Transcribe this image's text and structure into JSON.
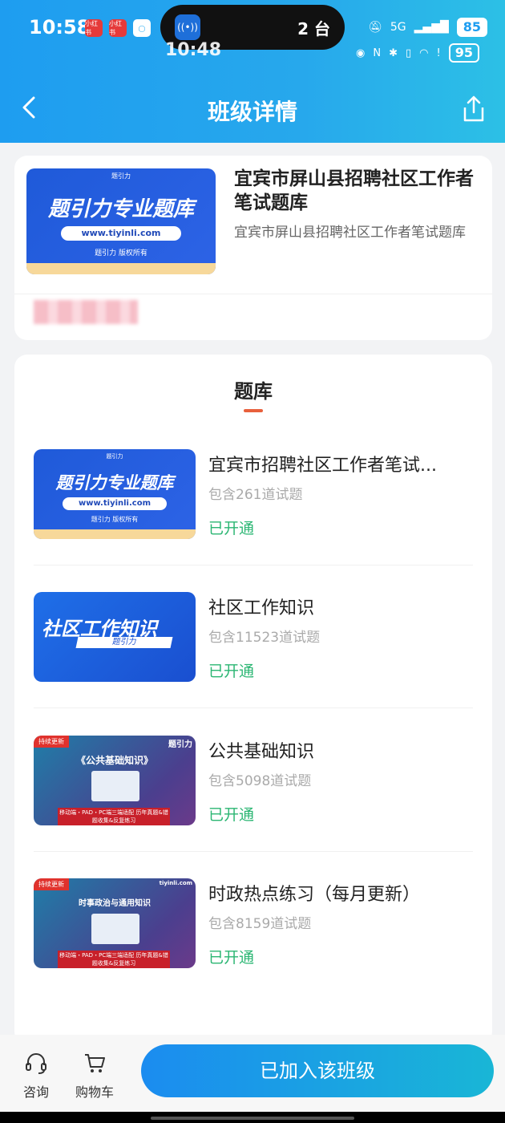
{
  "status_bar": {
    "time": "10:58",
    "badge1": "小红书",
    "badge2": "小红书",
    "island_count": "2 台",
    "signal": "5G",
    "battery": "85",
    "ghost_time": "10:48",
    "ghost_battery": "95"
  },
  "nav": {
    "title": "班级详情",
    "back_icon": "chevron-left-icon",
    "share_icon": "share-icon"
  },
  "course": {
    "title": "宜宾市屏山县招聘社区工作者笔试题库",
    "subtitle": "宜宾市屏山县招聘社区工作者笔试题库",
    "thumb_big": "题引力专业题库",
    "thumb_url": "www.tiyinli.com",
    "thumb_owner": "题引力 版权所有",
    "thumb_brand": "题引力"
  },
  "bank_section": {
    "title": "题库",
    "items": [
      {
        "title": "宜宾市招聘社区工作者笔试...",
        "count": "包含261道试题",
        "status": "已开通",
        "thumb_big": "题引力专业题库",
        "thumb_url": "www.tiyinli.com",
        "thumb_owner": "题引力 版权所有",
        "thumb_brand": "题引力"
      },
      {
        "title": "社区工作知识",
        "count": "包含11523道试题",
        "status": "已开通",
        "thumb_big": "社区工作知识",
        "thumb_sub": "题引力"
      },
      {
        "title": "公共基础知识",
        "count": "包含5098道试题",
        "status": "已开通",
        "thumb_tag": "持续更新",
        "thumb_title": "《公共基础知识》",
        "thumb_logo": "题引力",
        "thumb_ribbon": "移动端・PAD・PC端三端适配 历年真题&错题收集&反复练习"
      },
      {
        "title": "时政热点练习（每月更新）",
        "count": "包含8159道试题",
        "status": "已开通",
        "thumb_tag": "持续更新",
        "thumb_title": "时事政治与通用知识",
        "thumb_logo": "tiyinli.com",
        "thumb_ribbon": "移动端・PAD・PC端三端适配 历年真题&错题收集&反复练习"
      }
    ]
  },
  "bottom": {
    "consult": "咨询",
    "cart": "购物车",
    "join": "已加入该班级",
    "consult_icon": "headset-icon",
    "cart_icon": "cart-icon"
  },
  "colors": {
    "header_gradient_start": "#1e9df0",
    "header_gradient_end": "#2cc0e6",
    "status_green": "#2bb673",
    "tab_accent": "#e8603c",
    "button_start": "#1b8cf0",
    "button_end": "#19b6d6"
  }
}
